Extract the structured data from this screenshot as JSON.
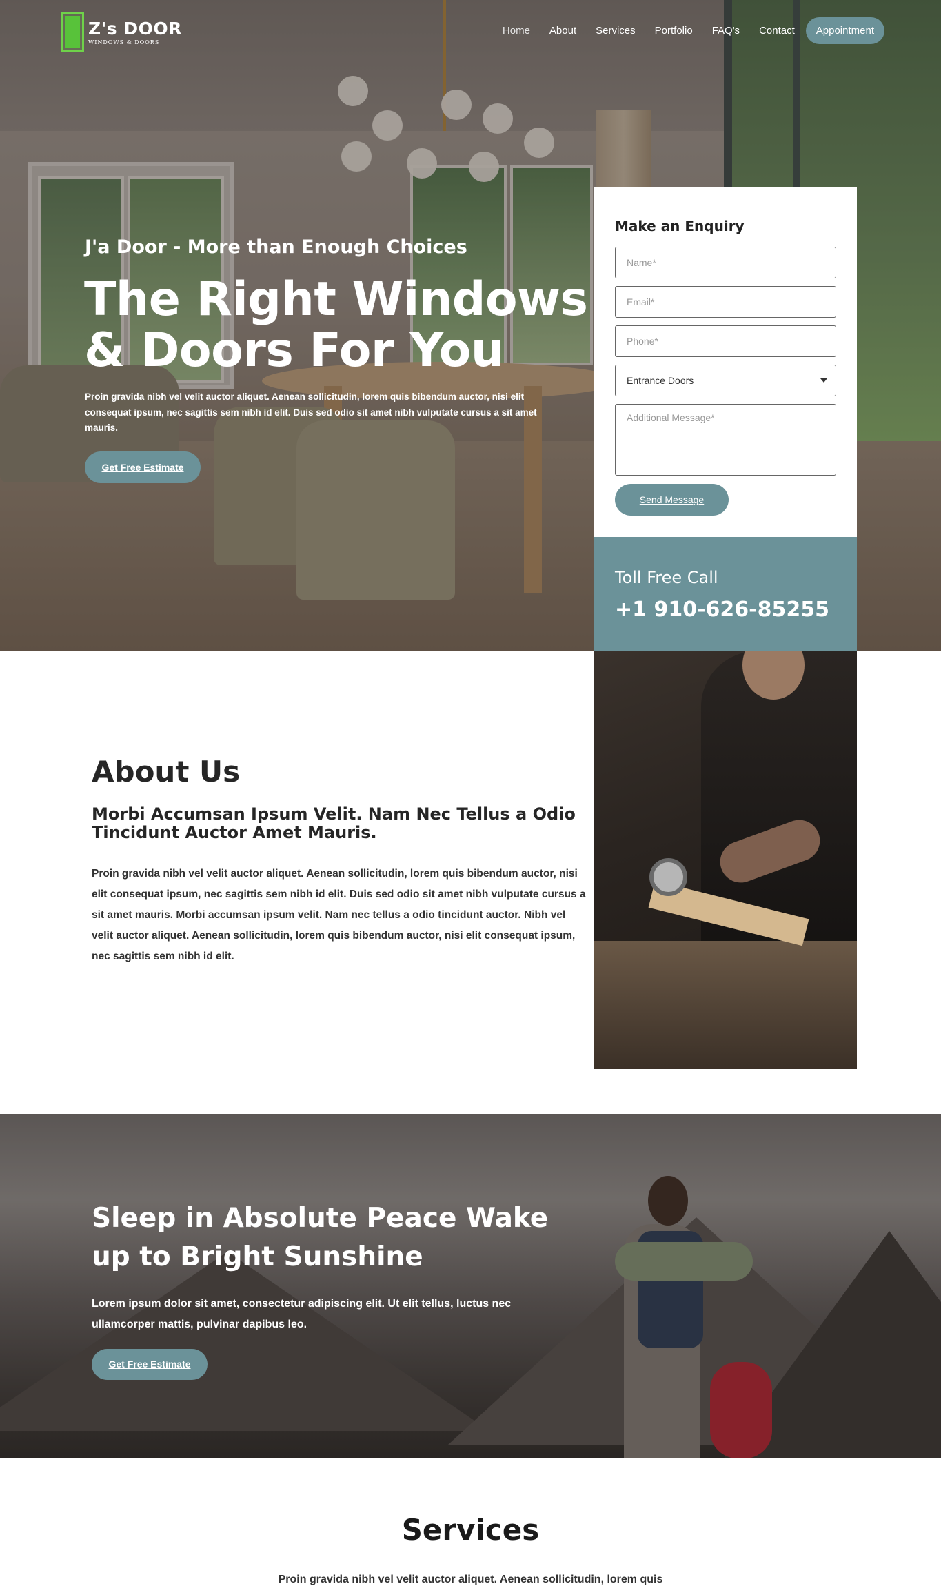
{
  "brand": {
    "name": "Z's DOOR",
    "tagline": "WINDOWS & DOORS",
    "logo_icon": "door-icon",
    "accent_color": "#6b9299",
    "logo_color": "#6fd24a"
  },
  "nav": {
    "items": [
      "Home",
      "About",
      "Services",
      "Portfolio",
      "FAQ's",
      "Contact"
    ],
    "cta": "Appointment"
  },
  "hero": {
    "tagline": "J'a Door - More than Enough Choices",
    "title": "The Right Windows & Doors For You",
    "description": "Proin gravida nibh vel velit auctor aliquet. Aenean sollicitudin, lorem quis bibendum auctor, nisi elit consequat ipsum, nec sagittis sem nibh id elit. Duis sed odio sit amet nibh vulputate cursus a sit amet mauris.",
    "button": "Get Free Estimate"
  },
  "enquiry": {
    "title": "Make an Enquiry",
    "name_placeholder": "Name*",
    "email_placeholder": "Email*",
    "phone_placeholder": "Phone*",
    "select_value": "Entrance Doors",
    "message_placeholder": "Additional Message*",
    "submit": "Send Message"
  },
  "tollfree": {
    "label": "Toll Free Call",
    "number": "+1 910-626-85255"
  },
  "about": {
    "title": "About Us",
    "subtitle": "Morbi Accumsan Ipsum Velit. Nam Nec Tellus a Odio Tincidunt Auctor Amet Mauris.",
    "text": "Proin gravida nibh vel velit auctor aliquet. Aenean sollicitudin, lorem quis bibendum auctor, nisi elit consequat ipsum, nec sagittis sem nibh id elit. Duis sed odio sit amet nibh vulputate cursus a sit amet mauris. Morbi accumsan ipsum velit. Nam nec tellus a odio tincidunt auctor. Nibh vel velit auctor aliquet. Aenean sollicitudin, lorem quis bibendum auctor, nisi elit consequat ipsum, nec sagittis sem nibh id elit."
  },
  "banner": {
    "title": "Sleep in Absolute Peace Wake up to Bright Sunshine",
    "text": "Lorem ipsum dolor sit amet, consectetur adipiscing elit. Ut elit tellus, luctus nec ullamcorper mattis, pulvinar dapibus leo.",
    "button": "Get Free Estimate"
  },
  "services": {
    "title": "Services",
    "text": "Proin gravida nibh vel velit auctor aliquet. Aenean sollicitudin, lorem quis"
  }
}
